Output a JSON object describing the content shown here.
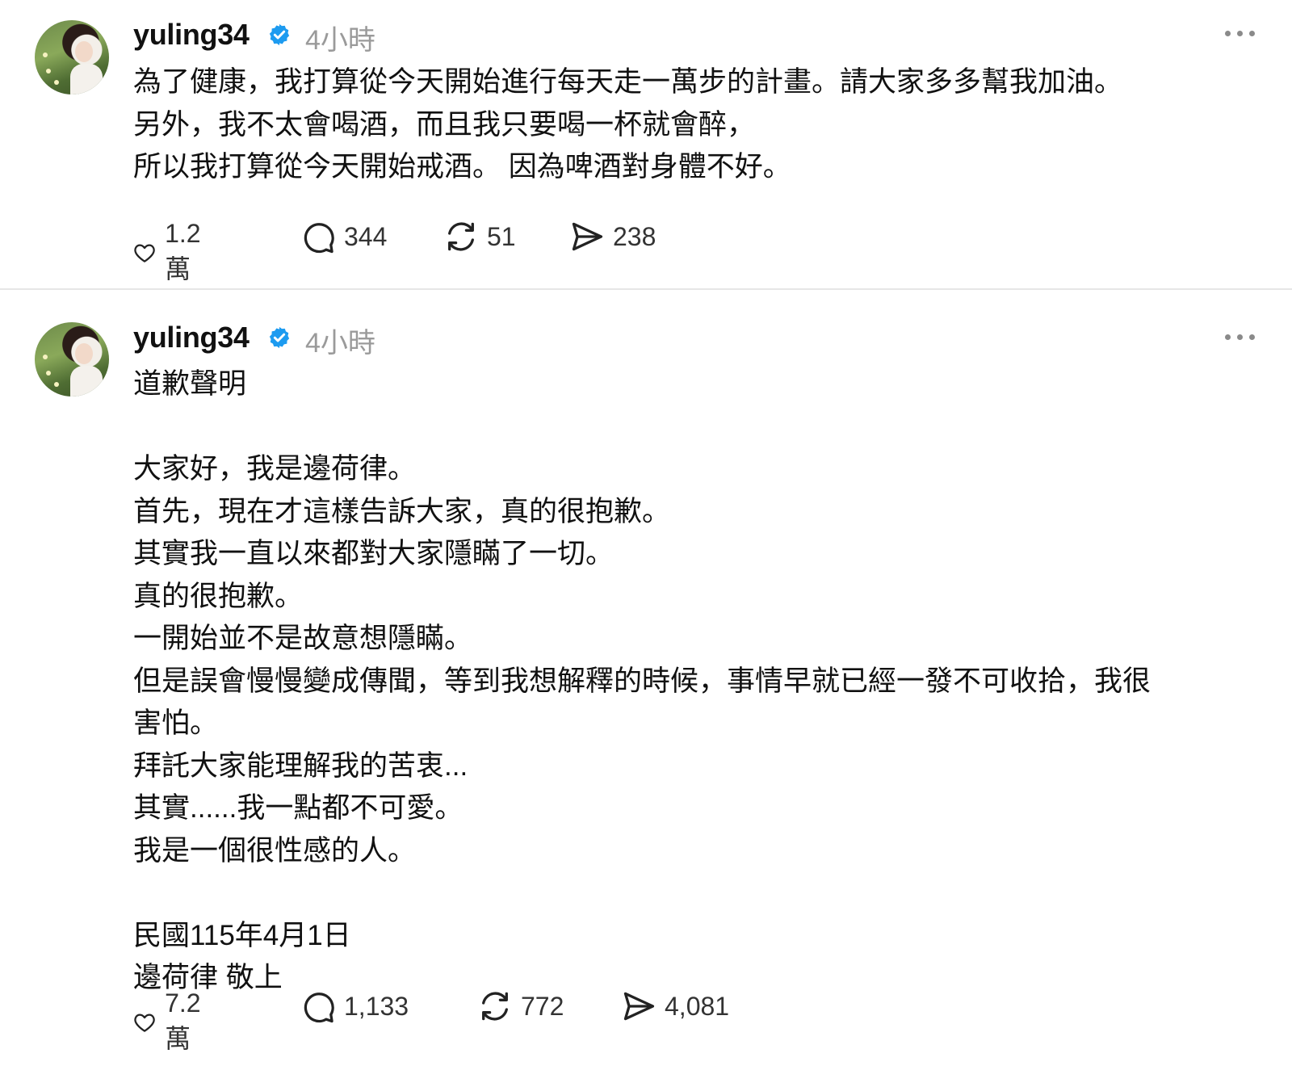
{
  "posts": [
    {
      "username": "yuling34",
      "time": "4小時",
      "lines": [
        "為了健康，我打算從今天開始進行每天走一萬步的計畫。請大家多多幫我加油。",
        "另外，我不太會喝酒，而且我只要喝一杯就會醉，",
        "所以我打算從今天開始戒酒。 因為啤酒對身體不好。"
      ],
      "likes": "1.2 萬",
      "comments": "344",
      "reposts": "51",
      "shares": "238"
    },
    {
      "username": "yuling34",
      "time": "4小時",
      "lines": [
        "道歉聲明",
        "",
        "大家好，我是邊荷律。",
        "首先，現在才這樣告訴大家，真的很抱歉。",
        "其實我一直以來都對大家隱瞞了一切。",
        "真的很抱歉。",
        "一開始並不是故意想隱瞞。",
        "但是誤會慢慢變成傳聞，等到我想解釋的時候，事情早就已經一發不可收拾，我很",
        "害怕。",
        "拜託大家能理解我的苦衷...",
        "其實......我一點都不可愛。",
        "我是一個很性感的人。",
        "",
        "民國115年4月1日",
        "邊荷律 敬上"
      ],
      "likes": "7.2 萬",
      "comments": "1,133",
      "reposts": "772",
      "shares": "4,081"
    }
  ],
  "icons": {
    "verified": "verified-badge-icon",
    "like": "heart-icon",
    "comment": "comment-bubble-icon",
    "repost": "repost-icon",
    "share": "send-icon",
    "more": "more-dots-icon"
  },
  "colors": {
    "verified": "#1d9bf0",
    "muted": "#9a9a9a"
  }
}
